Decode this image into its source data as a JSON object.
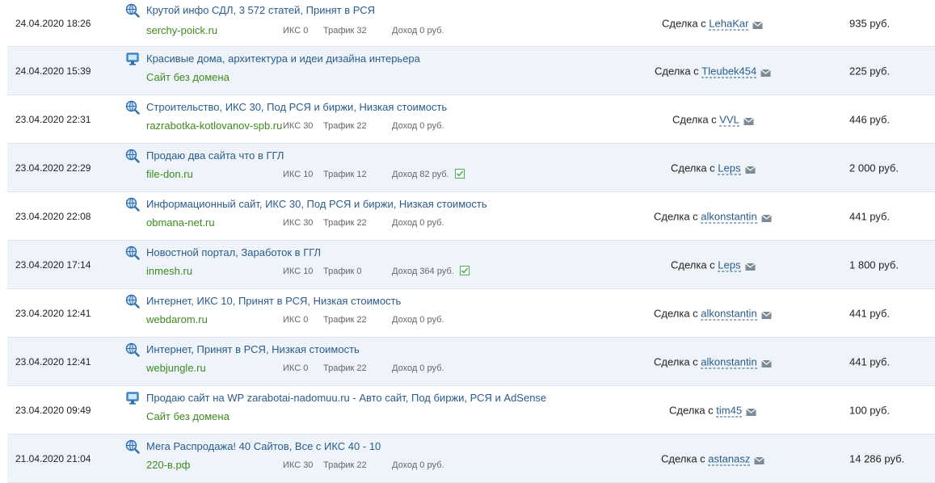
{
  "deal_prefix": "Сделка с",
  "stats": {
    "iks_label": "ИКС",
    "traffic_label": "Трафик",
    "income_label": "Доход",
    "currency": "руб."
  },
  "rows": [
    {
      "date": "24.04.2020 18:26",
      "icon": "globe-search-icon",
      "title": "Крутой инфо СДЛ, 3 572 статей, Принят в РСЯ",
      "domain": "serchy-poick.ru",
      "iks": "ИКС 0",
      "traffic": "Трафик 32",
      "income": "Доход 0 руб.",
      "checked": false,
      "user": "LehaKar",
      "price": "935 руб."
    },
    {
      "date": "24.04.2020 15:39",
      "icon": "monitor-icon",
      "title": "Красивые дома, архитектура и идеи дизайна интерьера",
      "domain": "Сайт без домена",
      "iks": "",
      "traffic": "",
      "income": "",
      "checked": false,
      "user": "Tleubek454",
      "price": "225 руб."
    },
    {
      "date": "23.04.2020 22:31",
      "icon": "globe-search-icon",
      "title": "Строительство, ИКС 30, Под РСЯ и биржи, Низкая стоимость",
      "domain": "razrabotka-kotlovanov-spb.ru",
      "iks": "ИКС 30",
      "traffic": "Трафик 22",
      "income": "Доход 0 руб.",
      "checked": false,
      "user": "VVL",
      "price": "446 руб."
    },
    {
      "date": "23.04.2020 22:29",
      "icon": "globe-search-icon",
      "title": "Продаю два сайта что в ГГЛ",
      "domain": "file-don.ru",
      "iks": "ИКС 10",
      "traffic": "Трафик 12",
      "income": "Доход 82 руб.",
      "checked": true,
      "user": "Leps",
      "price": "2 000 руб."
    },
    {
      "date": "23.04.2020 22:08",
      "icon": "globe-search-icon",
      "title": "Информационный сайт, ИКС 30, Под РСЯ и биржи, Низкая стоимость",
      "domain": "obmana-net.ru",
      "iks": "ИКС 30",
      "traffic": "Трафик 22",
      "income": "Доход 0 руб.",
      "checked": false,
      "user": "alkonstantin",
      "price": "441 руб."
    },
    {
      "date": "23.04.2020 17:14",
      "icon": "globe-search-icon",
      "title": "Новостной портал, Заработок в ГГЛ",
      "domain": "inmesh.ru",
      "iks": "ИКС 10",
      "traffic": "Трафик 0",
      "income": "Доход 364 руб.",
      "checked": true,
      "user": "Leps",
      "price": "1 800 руб."
    },
    {
      "date": "23.04.2020 12:41",
      "icon": "globe-search-icon",
      "title": "Интернет, ИКС 10, Принят в РСЯ, Низкая стоимость",
      "domain": "webdarom.ru",
      "iks": "ИКС 0",
      "traffic": "Трафик 22",
      "income": "Доход 0 руб.",
      "checked": false,
      "user": "alkonstantin",
      "price": "441 руб."
    },
    {
      "date": "23.04.2020 12:41",
      "icon": "globe-search-icon",
      "title": "Интернет, Принят в РСЯ, Низкая стоимость",
      "domain": "webjungle.ru",
      "iks": "ИКС 0",
      "traffic": "Трафик 22",
      "income": "Доход 0 руб.",
      "checked": false,
      "user": "alkonstantin",
      "price": "441 руб."
    },
    {
      "date": "23.04.2020 09:49",
      "icon": "monitor-icon",
      "title": "Продаю сайт на WP zarabotai-nadomuu.ru - Авто сайт, Под биржи, РСЯ и AdSense",
      "domain": "Сайт без домена",
      "iks": "",
      "traffic": "",
      "income": "",
      "checked": false,
      "user": "tim45",
      "price": "100 руб."
    },
    {
      "date": "21.04.2020 21:04",
      "icon": "globe-search-icon",
      "title": "Мега Распродажа! 40 Сайтов, Все с ИКС 40 - 10",
      "domain": "220-в.рф",
      "iks": "ИКС 30",
      "traffic": "Трафик 22",
      "income": "Доход 0 руб.",
      "checked": false,
      "user": "astanasz",
      "price": "14 286 руб."
    }
  ]
}
